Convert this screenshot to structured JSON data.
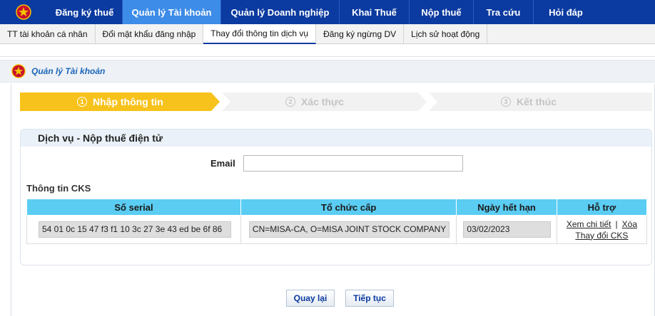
{
  "topnav": {
    "logo_icon": "national-emblem-icon",
    "items": [
      {
        "label": "Đăng ký thuế"
      },
      {
        "label": "Quản lý Tài khoản",
        "active": true
      },
      {
        "label": "Quản lý Doanh nghiệp"
      },
      {
        "label": "Khai Thuế"
      },
      {
        "label": "Nộp thuế"
      },
      {
        "label": "Tra cứu"
      },
      {
        "label": "Hỏi đáp"
      }
    ]
  },
  "subnav": {
    "items": [
      {
        "label": "TT tài khoản cá nhân"
      },
      {
        "label": "Đổi mật khẩu đăng nhập"
      },
      {
        "label": "Thay đổi thông tin dịch vụ",
        "active": true
      },
      {
        "label": "Đăng ký ngừng DV"
      },
      {
        "label": "Lịch sử hoạt động"
      }
    ]
  },
  "section": {
    "title": "Quản lý Tài khoản"
  },
  "steps": [
    {
      "num": "1",
      "label": "Nhập thông tin",
      "active": true
    },
    {
      "num": "2",
      "label": "Xác thực",
      "active": false
    },
    {
      "num": "3",
      "label": "Kết thúc",
      "active": false
    }
  ],
  "service": {
    "title": "Dịch vụ - Nộp thuế điện tử"
  },
  "form": {
    "email_label": "Email",
    "email_value": ""
  },
  "cks": {
    "title": "Thông tin CKS",
    "headers": [
      "Số serial",
      "Tổ chức cấp",
      "Ngày hết hạn",
      "Hỗ trợ"
    ],
    "row": {
      "serial": "54 01 0c 15 47 f3 f1 10 3c 27 3e 43 ed be 6f 86",
      "issuer": "CN=MISA-CA, O=MISA JOINT STOCK COMPANY",
      "expiry": "03/02/2023",
      "link_detail": "Xem chi tiết",
      "link_delete": "Xóa",
      "link_change": "Thay đổi CKS",
      "separator": "|"
    }
  },
  "buttons": {
    "back": "Quay lại",
    "next": "Tiếp tục"
  },
  "colors": {
    "nav_bg": "#0b3aa0",
    "nav_active": "#3d8ce8",
    "step_active": "#f7c21b",
    "table_header": "#5bcdf3"
  }
}
